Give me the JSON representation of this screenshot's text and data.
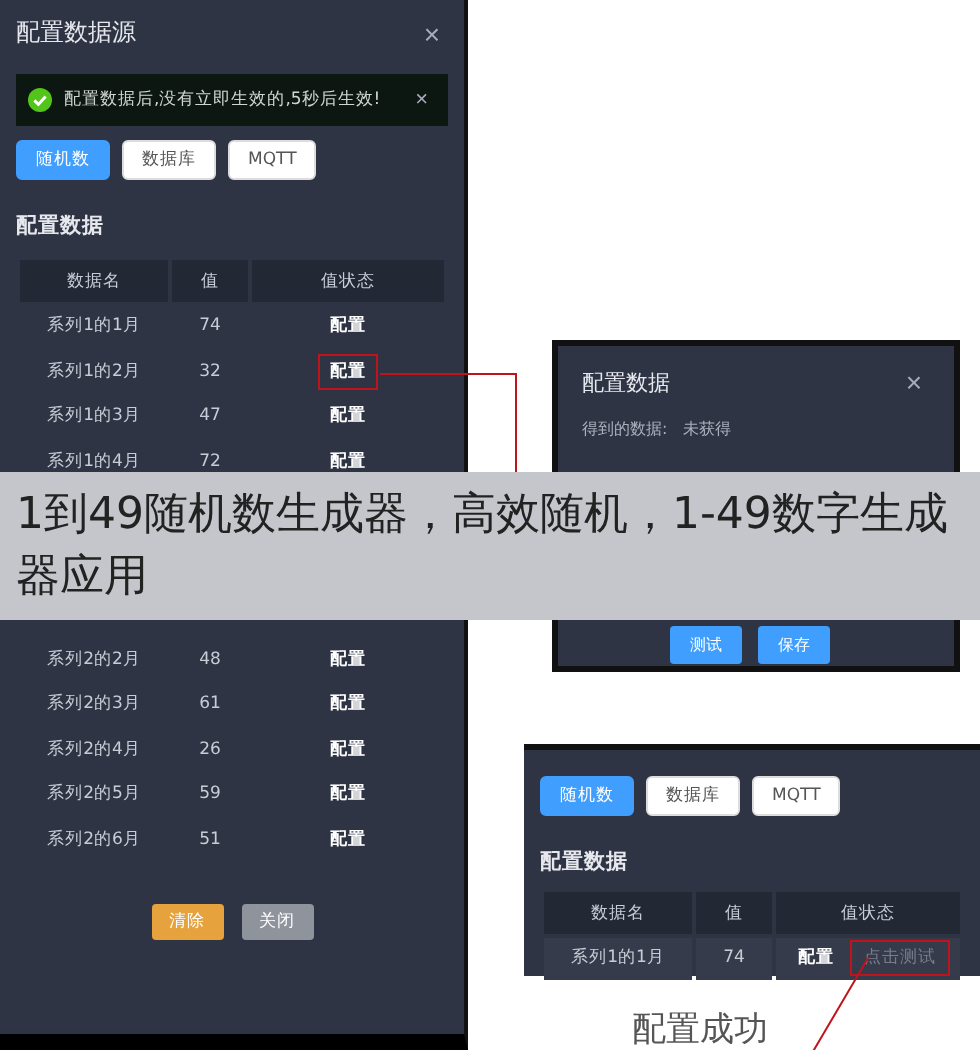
{
  "main_dialog": {
    "title": "配置数据源",
    "close": "×",
    "alert": {
      "text": "配置数据后,没有立即生效的,5秒后生效!",
      "close": "×"
    },
    "source_tabs": [
      {
        "label": "随机数",
        "selected": true
      },
      {
        "label": "数据库",
        "selected": false
      },
      {
        "label": "MQTT",
        "selected": false
      }
    ],
    "section_title": "配置数据",
    "table": {
      "columns": [
        "数据名",
        "值",
        "值状态"
      ],
      "rows": [
        {
          "name": "系列1的1月",
          "value": "74",
          "action": "配置",
          "highlighted": false
        },
        {
          "name": "系列1的2月",
          "value": "32",
          "action": "配置",
          "highlighted": true
        },
        {
          "name": "系列1的3月",
          "value": "47",
          "action": "配置",
          "highlighted": false
        },
        {
          "name": "系列1的4月",
          "value": "72",
          "action": "配置",
          "highlighted": false
        },
        {
          "name": "系列2的2月",
          "value": "48",
          "action": "配置",
          "highlighted": false
        },
        {
          "name": "系列2的3月",
          "value": "61",
          "action": "配置",
          "highlighted": false
        },
        {
          "name": "系列2的4月",
          "value": "26",
          "action": "配置",
          "highlighted": false
        },
        {
          "name": "系列2的5月",
          "value": "59",
          "action": "配置",
          "highlighted": false
        },
        {
          "name": "系列2的6月",
          "value": "51",
          "action": "配置",
          "highlighted": false
        }
      ]
    },
    "buttons": [
      {
        "label": "清除",
        "kind": "warning"
      },
      {
        "label": "关闭",
        "kind": "neutral"
      }
    ]
  },
  "config_dialog": {
    "title": "配置数据",
    "close": "×",
    "received_label": "得到的数据:",
    "received_value": "未获得",
    "buttons": [
      "测试",
      "保存"
    ]
  },
  "result_panel": {
    "source_tabs": [
      {
        "label": "随机数",
        "selected": true
      },
      {
        "label": "数据库",
        "selected": false
      },
      {
        "label": "MQTT",
        "selected": false
      }
    ],
    "section_title": "配置数据",
    "columns": [
      "数据名",
      "值",
      "值状态"
    ],
    "row": {
      "name": "系列1的1月",
      "value": "74",
      "action": "配置",
      "hint": "点击测试"
    }
  },
  "result_caption": "配置成功",
  "caption_banner": "1到49随机数生成器，高效随机，1-49数字生成器应用"
}
